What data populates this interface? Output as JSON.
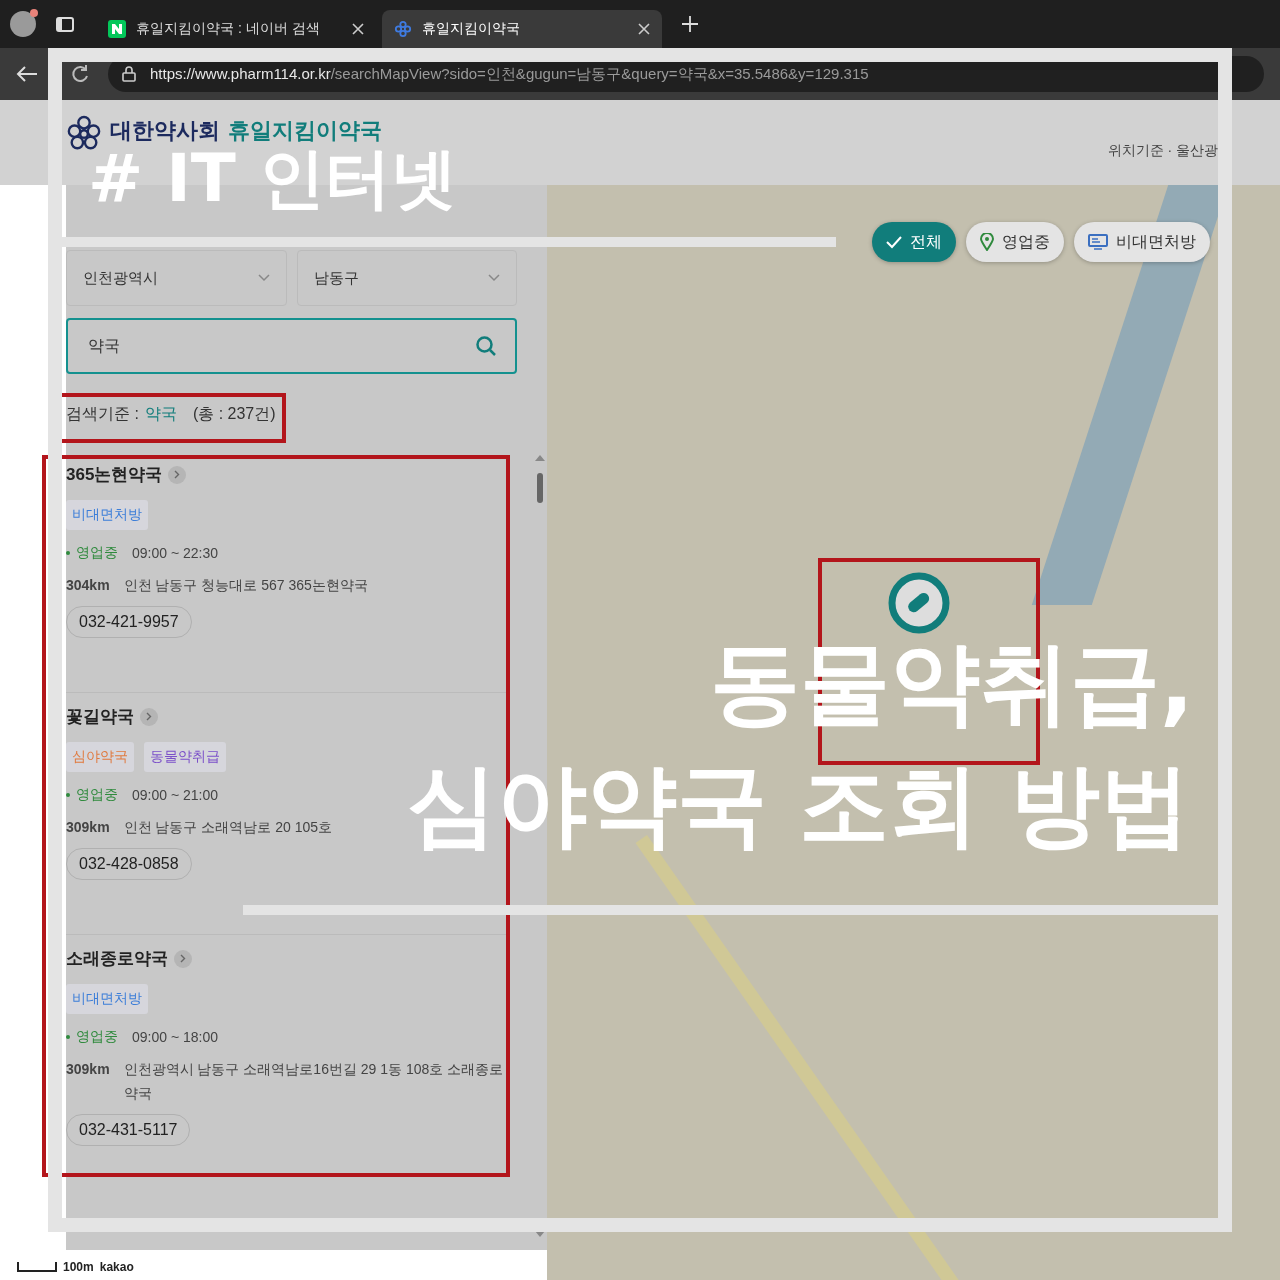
{
  "browser": {
    "tabs": [
      {
        "title": "휴일지킴이약국 : 네이버 검색",
        "kind": "naver",
        "selected": false
      },
      {
        "title": "휴일지킴이약국",
        "kind": "site",
        "selected": true
      }
    ],
    "url_host": "https://www.pharm114.or.kr",
    "url_path": "/searchMapView?sido=인천&gugun=남동구&query=약국&x=35.5486&y=129.315"
  },
  "header": {
    "org": "대한약사회",
    "service": "휴일지킴이약국",
    "location": "위치기준 · 울산광"
  },
  "sidebar": {
    "region": "인천광역시",
    "district": "남동구",
    "search_value": "약국",
    "criteria_label": "검색기준 :",
    "criteria_query": "약국",
    "total": "(총 : 237건)",
    "pharmacies": [
      {
        "name": "365논현약국",
        "tags": [
          {
            "label": "비대면처방",
            "color": "#3b7dd8"
          }
        ],
        "status": "영업중",
        "hours": "09:00 ~ 22:30",
        "distance": "304km",
        "address": "인천 남동구 청능대로 567 365논현약국",
        "phone": "032-421-9957"
      },
      {
        "name": "꽃길약국",
        "tags": [
          {
            "label": "심야약국",
            "color": "#e07a3f"
          },
          {
            "label": "동물약취급",
            "color": "#7b4fc9"
          }
        ],
        "status": "영업중",
        "hours": "09:00 ~ 21:00",
        "distance": "309km",
        "address": "인천 남동구 소래역남로 20 105호",
        "phone": "032-428-0858"
      },
      {
        "name": "소래종로약국",
        "tags": [
          {
            "label": "비대면처방",
            "color": "#3b7dd8"
          }
        ],
        "status": "영업중",
        "hours": "09:00 ~ 18:00",
        "distance": "309km",
        "address": "인천광역시 남동구 소래역남로16번길 29 1동 108호 소래종로약국",
        "phone": "032-431-5117"
      }
    ]
  },
  "map": {
    "filters": [
      {
        "label": "전체",
        "kind": "all",
        "selected": true
      },
      {
        "label": "영업중",
        "kind": "open",
        "selected": false
      },
      {
        "label": "비대면처방",
        "kind": "remote",
        "selected": false
      }
    ],
    "scale": "100m",
    "attribution": "kakao"
  },
  "overlay": {
    "tag": "# IT 인터넷",
    "title_lines": [
      "동물약취급,",
      "심야약국 조회 방법"
    ]
  }
}
